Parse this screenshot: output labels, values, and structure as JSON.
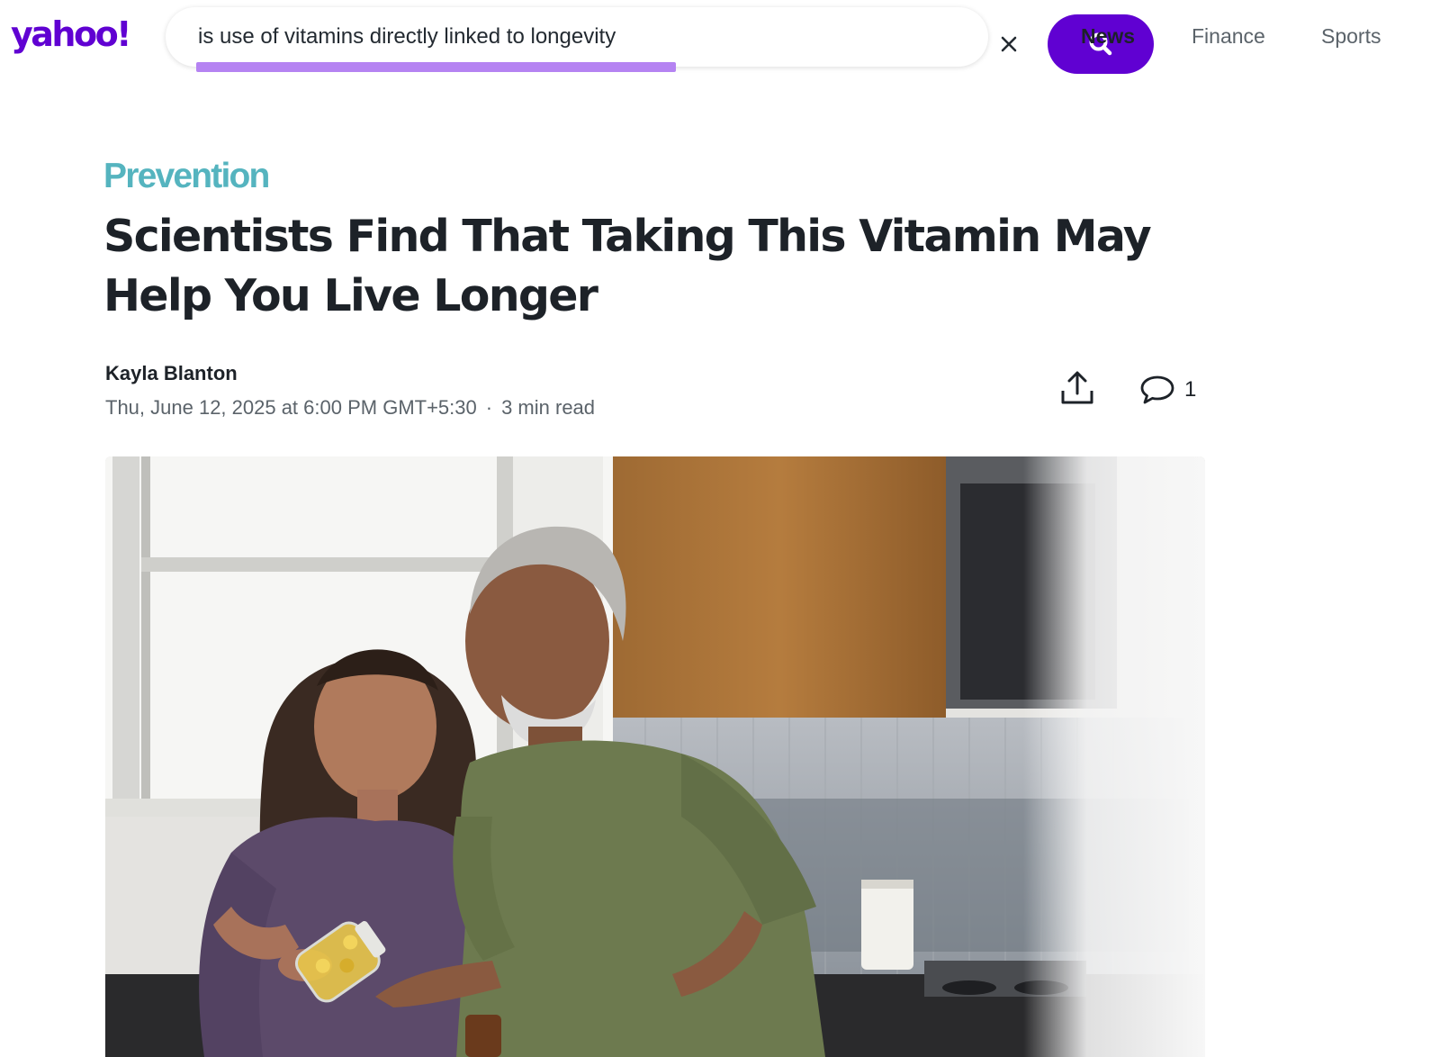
{
  "header": {
    "logo_text": "yahoo!",
    "search": {
      "query": "is use of vitamins directly linked to longevity",
      "clear_icon": "close-icon",
      "submit_icon": "search-icon"
    },
    "nav": [
      {
        "label": "News",
        "active": true
      },
      {
        "label": "Finance",
        "active": false
      },
      {
        "label": "Sports",
        "active": false
      }
    ]
  },
  "article": {
    "publisher": "Prevention",
    "headline": "Scientists Find That Taking This Vitamin May Help You Live Longer",
    "author": "Kayla Blanton",
    "date": "Thu, June 12, 2025 at 6:00 PM GMT+5:30",
    "separator": "·",
    "read_time": "3 min read",
    "share_icon": "share-icon",
    "comment_icon": "comment-icon",
    "comment_count": "1"
  },
  "colors": {
    "brand": "#6001d2",
    "highlight": "#b583f2",
    "publisher": "#55b4bf",
    "text": "#1d2228",
    "muted": "#5b636a"
  }
}
